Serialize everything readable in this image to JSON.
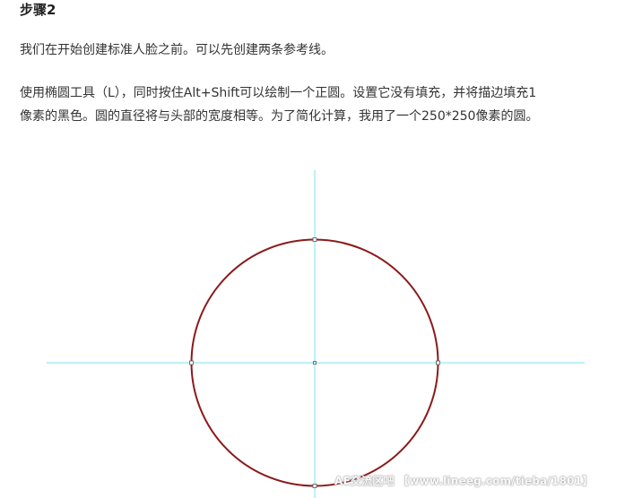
{
  "article": {
    "step_title": "步骤2",
    "paragraph1": "我们在开始创建标准人脸之前。可以先创建两条参考线。",
    "paragraph2_line1": "使用椭圆工具（L），同时按住Alt+Shift可以绘制一个正圆。设置它没有填充，并将描边填充1",
    "paragraph2_line2": "像素的黑色。圆的直径将与头部的宽度相等。为了简化计算，我用了一个250*250像素的圆。"
  },
  "figure": {
    "guide_color": "#7fe3ee",
    "circle_stroke_color": "#8b1a1a",
    "anchor_color": "#555555"
  },
  "watermark": {
    "text": "AE交流区吧 【www.lineeg.com/tieba/1801】"
  }
}
